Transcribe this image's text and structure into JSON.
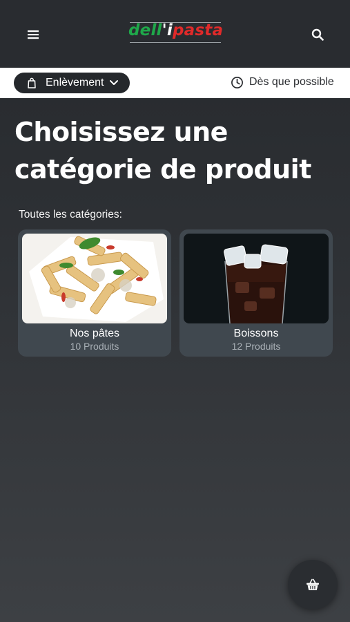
{
  "header": {
    "logo": {
      "part1": "dell",
      "apostrophe": "'",
      "part2": "i",
      "part3": "pasta"
    },
    "menu_icon": "hamburger-menu-icon",
    "search_icon": "search-icon"
  },
  "order_bar": {
    "mode": "Enlèvement",
    "time": "Dès que possible"
  },
  "main": {
    "title": "Choisissez une catégorie de produit",
    "section_label": "Toutes les catégories:",
    "categories": [
      {
        "name": "Nos pâtes",
        "count": "10 Produits"
      },
      {
        "name": "Boissons",
        "count": "12 Produits"
      }
    ]
  },
  "cart": {
    "icon": "basket-icon"
  },
  "colors": {
    "background": "#2f3236",
    "header": "#292c30",
    "card": "#40484f",
    "logo_green": "#1fa84a",
    "logo_red": "#e02a2a"
  }
}
